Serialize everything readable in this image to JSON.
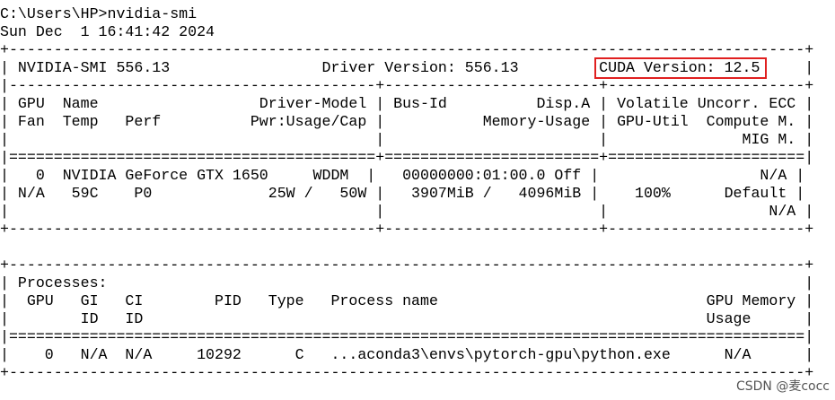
{
  "theme": {
    "background": "#ffffff",
    "text_color": "#000000",
    "highlight_color": "#e02020",
    "watermark_color": "#555555"
  },
  "terminal": {
    "lines": [
      "C:\\Users\\HP>nvidia-smi",
      "Sun Dec  1 16:41:42 2024",
      "+-----------------------------------------------------------------------------------------+",
      "| NVIDIA-SMI 556.13                 Driver Version: 556.13         CUDA Version: 12.5     |",
      "|-----------------------------------------+------------------------+----------------------+",
      "| GPU  Name                  Driver-Model | Bus-Id          Disp.A | Volatile Uncorr. ECC |",
      "| Fan  Temp   Perf          Pwr:Usage/Cap |           Memory-Usage | GPU-Util  Compute M. |",
      "|                                         |                        |               MIG M. |",
      "|=========================================+========================+======================|",
      "|   0  NVIDIA GeForce GTX 1650     WDDM  |   00000000:01:00.0 Off |                  N/A |",
      "| N/A   59C    P0             25W /   50W |   3907MiB /   4096MiB |    100%      Default |",
      "|                                         |                        |                  N/A |",
      "+-----------------------------------------+------------------------+----------------------+",
      "",
      "+-----------------------------------------------------------------------------------------+",
      "| Processes:                                                                              |",
      "|  GPU   GI   CI        PID   Type   Process name                              GPU Memory |",
      "|        ID   ID                                                               Usage      |",
      "|=========================================================================================|",
      "|    0   N/A  N/A     10292      C   ...aconda3\\envs\\pytorch-gpu\\python.exe      N/A      |",
      "+-----------------------------------------------------------------------------------------+"
    ]
  },
  "watermark": {
    "text": "CSDN @麦cocc"
  }
}
